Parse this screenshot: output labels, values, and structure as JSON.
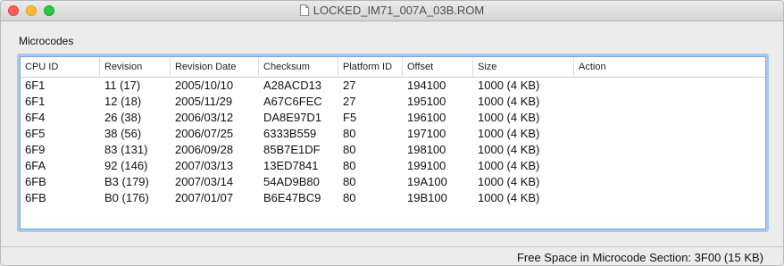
{
  "window": {
    "title": "LOCKED_IM71_007A_03B.ROM",
    "icon": "document-icon"
  },
  "section": {
    "label": "Microcodes"
  },
  "table": {
    "columns": [
      "CPU ID",
      "Revision",
      "Revision Date",
      "Checksum",
      "Platform ID",
      "Offset",
      "Size",
      "Action"
    ],
    "rows": [
      [
        "6F1",
        "11 (17)",
        "2005/10/10",
        "A28ACD13",
        "27",
        "194100",
        "1000 (4 KB)",
        ""
      ],
      [
        "6F1",
        "12 (18)",
        "2005/11/29",
        "A67C6FEC",
        "27",
        "195100",
        "1000 (4 KB)",
        ""
      ],
      [
        "6F4",
        "26 (38)",
        "2006/03/12",
        "DA8E97D1",
        "F5",
        "196100",
        "1000 (4 KB)",
        ""
      ],
      [
        "6F5",
        "38 (56)",
        "2006/07/25",
        "6333B559",
        "80",
        "197100",
        "1000 (4 KB)",
        ""
      ],
      [
        "6F9",
        "83 (131)",
        "2006/09/28",
        "85B7E1DF",
        "80",
        "198100",
        "1000 (4 KB)",
        ""
      ],
      [
        "6FA",
        "92 (146)",
        "2007/03/13",
        "13ED7841",
        "80",
        "199100",
        "1000 (4 KB)",
        ""
      ],
      [
        "6FB",
        "B3 (179)",
        "2007/03/14",
        "54AD9B80",
        "80",
        "19A100",
        "1000 (4 KB)",
        ""
      ],
      [
        "6FB",
        "B0 (176)",
        "2007/01/07",
        "B6E47BC9",
        "80",
        "19B100",
        "1000 (4 KB)",
        ""
      ]
    ]
  },
  "status": {
    "free_space": "Free Space in Microcode Section: 3F00 (15 KB)"
  }
}
